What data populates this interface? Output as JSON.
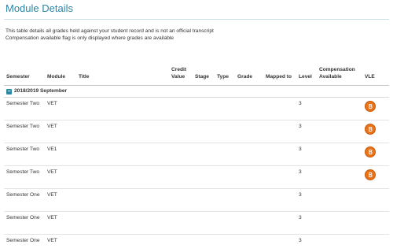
{
  "page": {
    "title": "Module Details",
    "description_line1": "This table details all grades held against your student record and is not an official transcript",
    "description_line2": "Compensation available flag is only displayed where grades are available"
  },
  "table": {
    "headers": {
      "semester": "Semester",
      "module": "Module",
      "title": "Title",
      "credit_value": "Credit Value",
      "stage": "Stage",
      "type": "Type",
      "grade": "Grade",
      "mapped_to": "Mapped to",
      "level": "Level",
      "compensation": "Compensation Available",
      "vle": "VLE"
    },
    "group": {
      "toggle": "−",
      "label": "2018/2019 September"
    },
    "rows": [
      {
        "semester": "Semester Two",
        "module": "VET",
        "level": "3",
        "vle": true
      },
      {
        "semester": "Semester Two",
        "module": "VET",
        "level": "3",
        "vle": true
      },
      {
        "semester": "Semester Two",
        "module": "VE1",
        "level": "3",
        "vle": true
      },
      {
        "semester": "Semester Two",
        "module": "VET",
        "level": "3",
        "vle": true
      },
      {
        "semester": "Semester One",
        "module": "VET",
        "level": "3",
        "vle": false
      },
      {
        "semester": "Semester One",
        "module": "VET",
        "level": "3",
        "vle": false
      },
      {
        "semester": "Semester One",
        "module": "VET",
        "level": "3",
        "vle": false
      }
    ]
  },
  "colors": {
    "accent": "#2a87a6",
    "vle_icon": "#e8731b"
  },
  "icons": {
    "vle": "blackboard-b-icon",
    "group_toggle": "collapse-minus-icon"
  }
}
